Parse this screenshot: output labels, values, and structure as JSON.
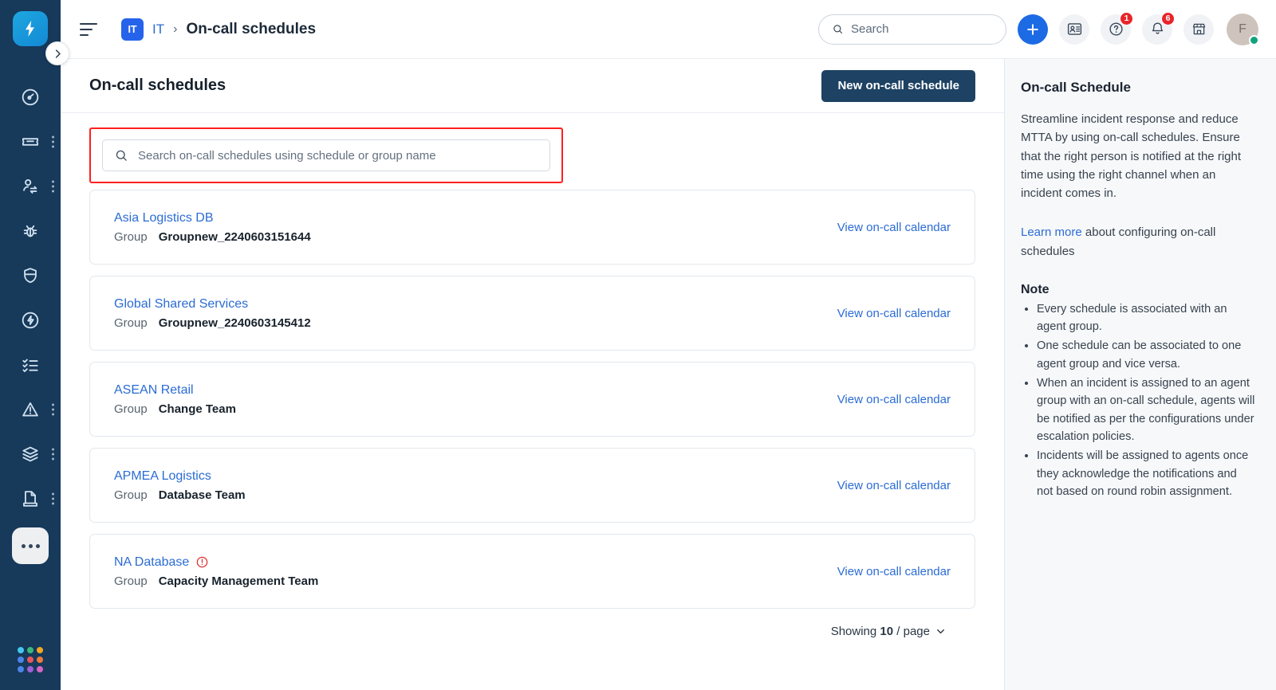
{
  "brand": {
    "logo_icon": "bolt-logo-icon",
    "accent": "#1d6ae5",
    "rail_bg": "#17395a",
    "danger": "#e8252a",
    "link": "#2b6cd4"
  },
  "rail": {
    "items": [
      {
        "icon": "dashboard-gauge-icon",
        "name": "sidebar-item-dashboard",
        "kebab": false
      },
      {
        "icon": "ticket-icon",
        "name": "sidebar-item-tickets",
        "kebab": true
      },
      {
        "icon": "user-swap-icon",
        "name": "sidebar-item-requesters",
        "kebab": true
      },
      {
        "icon": "bug-icon",
        "name": "sidebar-item-problems",
        "kebab": false
      },
      {
        "icon": "shield-icon",
        "name": "sidebar-item-assets",
        "kebab": false
      },
      {
        "icon": "bolt-circle-icon",
        "name": "sidebar-item-changes",
        "kebab": false
      },
      {
        "icon": "checklist-icon",
        "name": "sidebar-item-tasks",
        "kebab": false
      },
      {
        "icon": "alert-triangle-icon",
        "name": "sidebar-item-incidents",
        "kebab": true
      },
      {
        "icon": "layers-icon",
        "name": "sidebar-item-services",
        "kebab": true
      },
      {
        "icon": "document-icon",
        "name": "sidebar-item-releases",
        "kebab": true
      }
    ],
    "more_label": "More",
    "app_switcher": {
      "name": "app-switcher-icon",
      "colors": [
        "#45c6ef",
        "#3ab87a",
        "#f5a524",
        "#4b86e8",
        "#e8565b",
        "#ef7a3a",
        "#4b86e8",
        "#a05ed8",
        "#d765c4"
      ]
    },
    "collapse_icon": "chevron-right-icon"
  },
  "topbar": {
    "menu_icon": "hamburger-icon",
    "breadcrumb": {
      "badge": "IT",
      "workspace": "IT",
      "separator": "›",
      "current": "On-call schedules"
    },
    "search": {
      "icon": "search-icon",
      "value": "",
      "placeholder": "Search"
    },
    "actions": [
      {
        "name": "new-item-button",
        "icon": "plus-icon",
        "badge": ""
      },
      {
        "name": "contacts-button",
        "icon": "contact-card-icon",
        "badge": ""
      },
      {
        "name": "help-button",
        "icon": "help-circle-icon",
        "badge": "1"
      },
      {
        "name": "notifications-button",
        "icon": "bell-icon",
        "badge": "6"
      },
      {
        "name": "marketplace-button",
        "icon": "storefront-icon",
        "badge": ""
      }
    ],
    "avatar": {
      "initials": "F",
      "presence": "online"
    }
  },
  "page": {
    "title": "On-call schedules",
    "new_button": "New on-call schedule",
    "list_search": {
      "icon": "search-icon",
      "value": "",
      "placeholder": "Search on-call schedules using schedule or group name"
    },
    "group_label": "Group",
    "action_label": "View on-call calendar",
    "schedules": [
      {
        "name": "Asia Logistics DB",
        "group": "Groupnew_2240603151644",
        "warning": false
      },
      {
        "name": "Global Shared Services",
        "group": "Groupnew_2240603145412",
        "warning": false
      },
      {
        "name": "ASEAN Retail",
        "group": "Change Team",
        "warning": false
      },
      {
        "name": "APMEA Logistics",
        "group": "Database Team",
        "warning": false
      },
      {
        "name": "NA Database",
        "group": "Capacity Management Team",
        "warning": true
      }
    ],
    "pager": {
      "prefix": "Showing",
      "count": "10",
      "suffix": "/ page",
      "icon": "chevron-down-icon"
    }
  },
  "side_panel": {
    "title": "On-call Schedule",
    "paragraph": "Streamline incident response and reduce MTTA by using on-call schedules. Ensure that the right person is notified at the right time using the right channel when an incident comes in.",
    "learn_link": "Learn more",
    "learn_rest": " about configuring on-call schedules",
    "note_title": "Note",
    "notes": [
      "Every schedule is associated with an agent group.",
      "One schedule can be associated to one agent group and vice versa.",
      "When an incident is assigned to an agent group with an on-call schedule, agents will be notified as per the configurations under escalation policies.",
      "Incidents will be assigned to agents once they acknowledge the notifications and not based on round robin assignment."
    ]
  }
}
